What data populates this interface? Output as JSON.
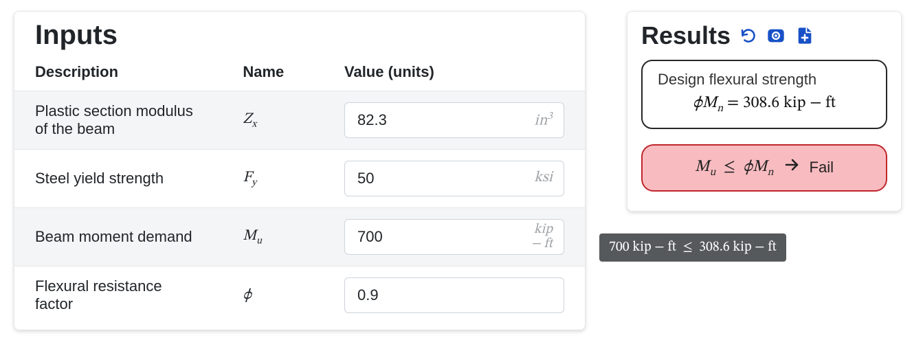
{
  "inputs": {
    "title": "Inputs",
    "headers": {
      "description": "Description",
      "name": "Name",
      "value": "Value (units)"
    },
    "rows": [
      {
        "description": "Plastic section modulus of the beam",
        "value": "82.3"
      },
      {
        "description": "Steel yield strength",
        "value": "50"
      },
      {
        "description": "Beam moment demand",
        "value": "700"
      },
      {
        "description": "Flexural resistance factor",
        "value": "0.9"
      }
    ]
  },
  "results": {
    "title": "Results",
    "design_strength": {
      "label": "Design flexural strength",
      "value": "308.6",
      "unit_text": "kip − ft"
    },
    "check": {
      "verdict": "Fail",
      "tooltip_lhs": "700 kip − ft",
      "tooltip_rhs": "308.6 kip − ft"
    }
  },
  "colors": {
    "accent_blue": "#1851c7",
    "fail_bg": "#f8bcc0",
    "fail_border": "#c0262d"
  }
}
